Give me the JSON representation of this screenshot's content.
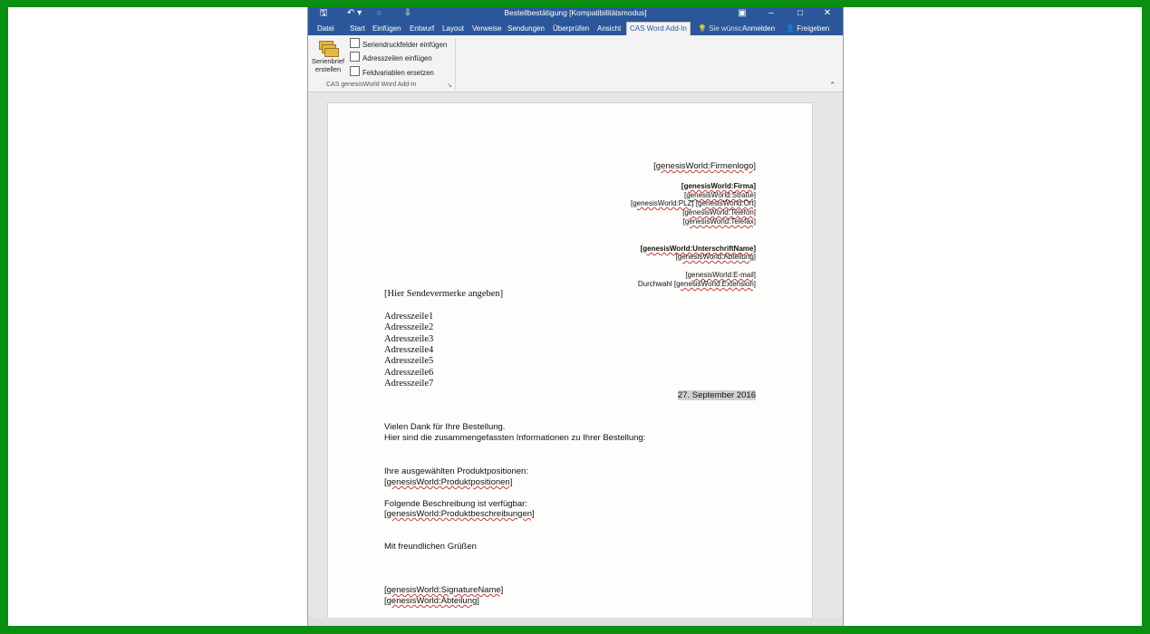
{
  "window": {
    "title": "Bestellbestätigung [Kompatibilitätsmodus]"
  },
  "titlebar_icons": {
    "save": "save-icon",
    "undo": "undo-icon",
    "redo": "redo-icon",
    "customize": "customize-icon",
    "ribbon_options": "ribbon-options-icon",
    "minimize": "minimize-icon",
    "maximize": "maximize-icon",
    "close": "close-icon",
    "glyphs": {
      "save": "🖫",
      "undo": "↶ ▾",
      "redo": "○",
      "customize": "⇩",
      "ribbon_options": "▣",
      "minimize": "–",
      "maximize": "□",
      "close": "✕"
    }
  },
  "tabs": {
    "datei": "Datei",
    "start": "Start",
    "einfuegen": "Einfügen",
    "entwurf": "Entwurf",
    "layout": "Layout",
    "verweise": "Verweise",
    "sendungen": "Sendungen",
    "ueberpruefen": "Überprüfen",
    "ansicht": "Ansicht",
    "cas": "CAS Word Add-In",
    "tellme": "Sie wünsc",
    "anmelden": "Anmelden",
    "freigeben": "Freigeben"
  },
  "ribbon": {
    "big_button_line1": "Serienbrief",
    "big_button_line2": "erstellen",
    "btn1": "Seriendruckfelder einfügen",
    "btn2": "Adresszeilen einfügen",
    "btn3": "Feldvariablen ersetzen",
    "group_label": "CAS genesisWorld Word Add-In",
    "collapse_glyph": "⌃",
    "launcher_glyph": "↘"
  },
  "document": {
    "firmenlogo": "[genesisWorld:Firmenlogo]",
    "firma": "[genesisWorld:Firma]",
    "strasse": "[genesisWorld:Straße]",
    "plz": "[genesisWorld:PLZ]",
    "ort": "[genesisWorld:Ort]",
    "telefon": "[genesisWorld:Telefon]",
    "telefax": "[genesisWorld:Telefax]",
    "unterschriftname": "[genesisWorld:UnterschriftName]",
    "abteilung_header": "[genesisWorld:Abteilung]",
    "email": "[genesisWorld:E-mail]",
    "durchwahl_label": "Durchwahl",
    "extension": "[genesisWorld:Extension]",
    "sendevermerke": "[Hier Sendevermerke angeben]",
    "adresszeilen": [
      "Adresszeile1",
      "Adresszeile2",
      "Adresszeile3",
      "Adresszeile4",
      "Adresszeile5",
      "Adresszeile6",
      "Adresszeile7"
    ],
    "datum": "27. September 2016",
    "dank": "Vielen Dank für Ihre Bestellung.",
    "info": "Hier sind die zusammengefassten Informationen zu Ihrer Bestellung:",
    "positionen_label": "Ihre ausgewählten Produktpositionen:",
    "positionen_field": "[genesisWorld:Produktpositionen]",
    "beschreibung_label": "Folgende Beschreibung ist verfügbar:",
    "beschreibung_field": "[genesisWorld:Produktbeschreibungen]",
    "gruss": "Mit freundlichen Grüßen",
    "signature": "[genesisWorld:SignatureName]",
    "abteilung_footer": "[genesisWorld:Abteilung]"
  },
  "colors": {
    "frame": "#0b8f12",
    "word_blue": "#2b579a",
    "field_underline": "#c23b3b"
  }
}
